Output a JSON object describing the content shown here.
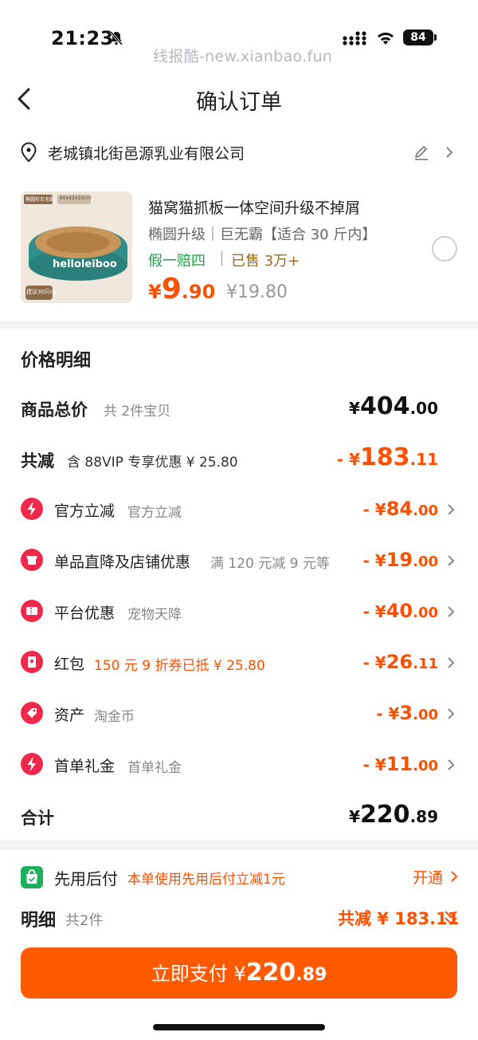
{
  "status": {
    "time": "21:23",
    "watermark": "线报酷-new.xianbao.fun",
    "battery": "84"
  },
  "header": {
    "title": "确认订单"
  },
  "address": {
    "text": "老城镇北街邑源乳业有限公司"
  },
  "product": {
    "image_tags": {
      "top_left": "椭圆形巨无霸",
      "top_right": "60x42x10cm",
      "brand": "helloleiboo",
      "bottom": "建议30斤内"
    },
    "name": "猫窝猫抓板一体空间升级不掉屑",
    "spec": "椭圆升级｜巨无霸【适合 30 斤内】",
    "tag_green": "假一赔四",
    "tag_sold": "已售 3万+",
    "price_yen": "¥",
    "price_int": "9",
    "price_dec": ".90",
    "price_original": "¥19.80"
  },
  "price_detail": {
    "title": "价格明细",
    "goods_total": {
      "label": "商品总价",
      "sub": "共 2件宝贝",
      "yen": "¥",
      "int": "404",
      "dec": ".00"
    },
    "total_reduce": {
      "label": "共减",
      "sub": "含 88VIP 专享优惠 ¥ 25.80",
      "prefix": "- ¥",
      "int": "183",
      "dec": ".11"
    },
    "discounts": [
      {
        "icon": "lightning-icon",
        "label": "官方立减",
        "sub": "官方立减",
        "prefix": "- ¥",
        "int": "84",
        "dec": ".00"
      },
      {
        "icon": "shop-icon",
        "label": "单品直降及店铺优惠",
        "sub": "满 120 元减 9 元等",
        "prefix": "- ¥",
        "int": "19",
        "dec": ".00"
      },
      {
        "icon": "ticket-icon",
        "label": "平台优惠",
        "sub": "宠物天降",
        "prefix": "- ¥",
        "int": "40",
        "dec": ".00"
      },
      {
        "icon": "red-packet-icon",
        "label": "红包",
        "sub": "150 元 9 折券已抵 ¥ 25.80",
        "prefix": "- ¥",
        "int": "26",
        "dec": ".11"
      },
      {
        "icon": "tag-icon",
        "label": "资产",
        "sub": "淘金币",
        "prefix": "- ¥",
        "int": "3",
        "dec": ".00"
      },
      {
        "icon": "lightning-icon",
        "label": "首单礼金",
        "sub": "首单礼金",
        "prefix": "- ¥",
        "int": "11",
        "dec": ".00"
      }
    ],
    "sum": {
      "label": "合计",
      "yen": "¥",
      "int": "220",
      "dec": ".89"
    }
  },
  "pay_later": {
    "label": "先用后付",
    "desc": "本单使用先用后付立减1元",
    "action": "开通"
  },
  "detail": {
    "label": "明细",
    "count": "共2件",
    "total": "共减 ¥ 183.11"
  },
  "pay_button": {
    "label": "立即支付",
    "yen": "¥",
    "int": "220",
    "dec": ".89"
  },
  "colors": {
    "accent": "#ff5000",
    "green": "#1fa348",
    "icon_red": "#f0284a"
  }
}
